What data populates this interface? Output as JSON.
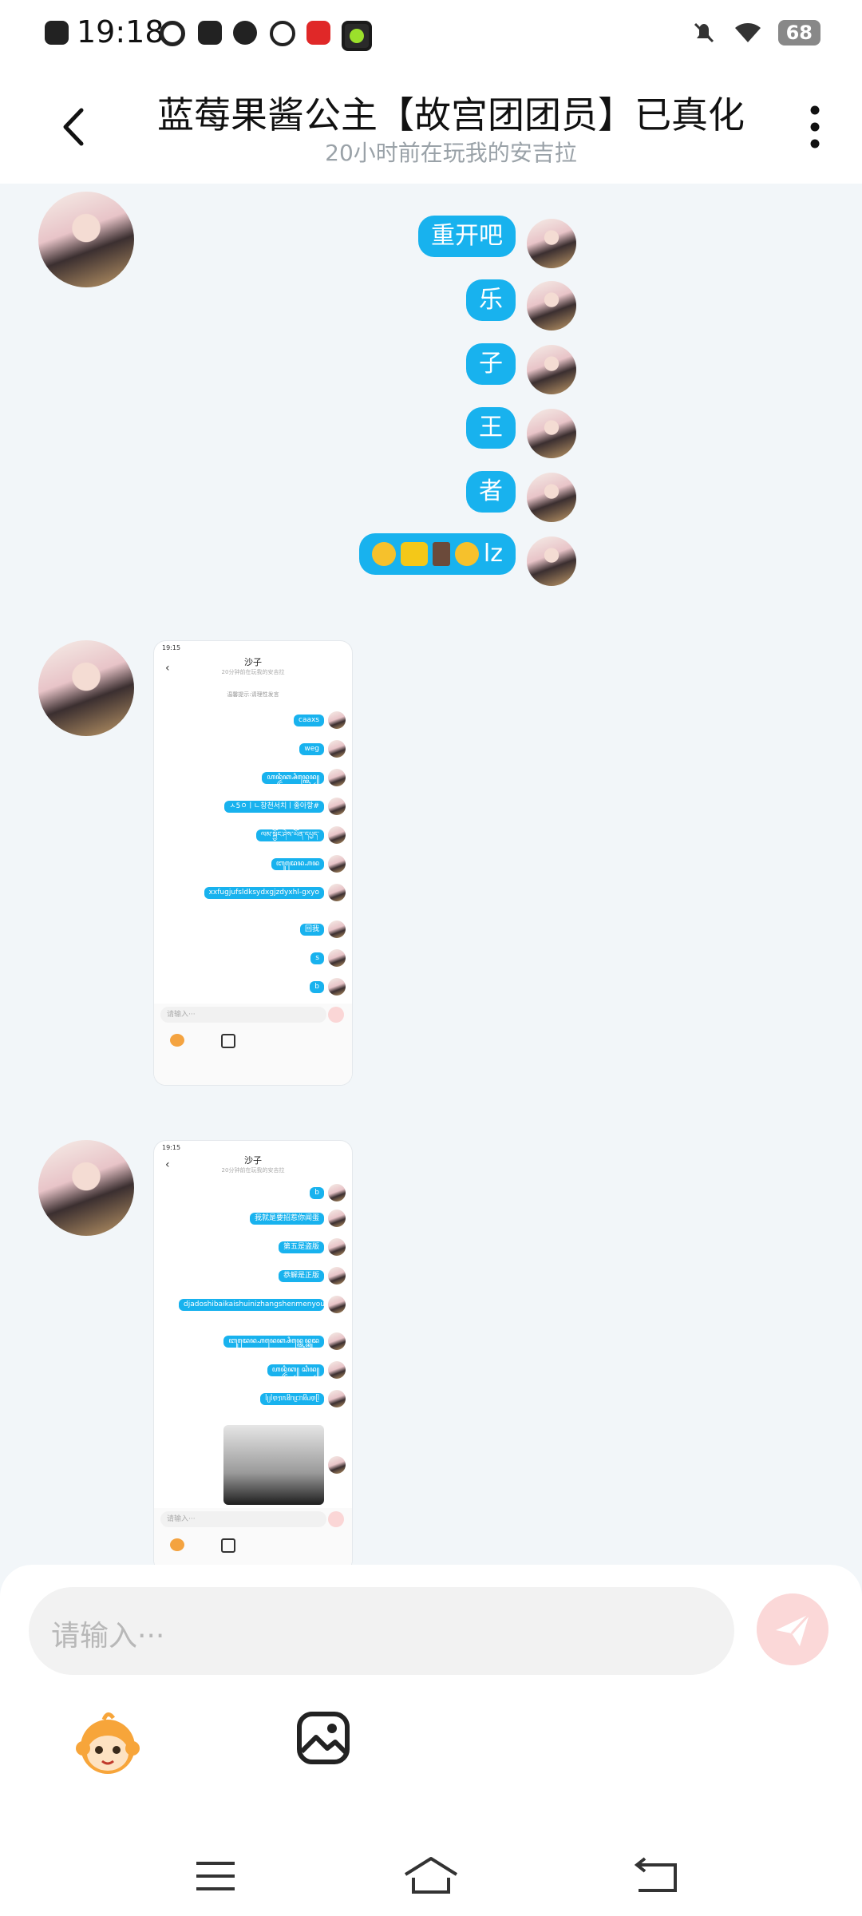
{
  "status_bar": {
    "time": "19:18",
    "battery": "68"
  },
  "header": {
    "title": "蓝莓果酱公主【故宫团团员】已真化",
    "subtitle": "20小时前在玩我的安吉拉"
  },
  "messages": [
    {
      "text": "重开吧"
    },
    {
      "text": "乐"
    },
    {
      "text": "子"
    },
    {
      "text": "王"
    },
    {
      "text": "者"
    },
    {
      "text": "lz",
      "emojis": [
        "nerd-face-emoji",
        "w-badge-emoji",
        "book-emoji",
        "crying-face-emoji"
      ]
    }
  ],
  "shot1": {
    "title": "沙子",
    "subtitle": "20分钟前在玩我的安吉拉",
    "notice": "温馨提示:请理性发言",
    "rows": [
      "caaxs",
      "weg",
      "ꦲꦤ꧀ꦢꦶꦏ꧀ꦱꦶꦤ꧀ꦠꦺꦤ꧀",
      "ㅅ5ㅇㅣㄴ창천서치ㅣ좋아핳#",
      "ལམ་སྐྱོང་ཤེས་ཡོན་དཔྱད་",
      "ꦧꦸꦢꦺꦤ꧀ꦲꦤ",
      "xxfugjufsldksydxgjzdyxhl-gxyo",
      "回我",
      "s",
      "b"
    ],
    "input_placeholder": "请输入···"
  },
  "shot2": {
    "title": "沙子",
    "subtitle": "20分钟前在玩我的安吉拉",
    "rows": [
      "b",
      "我就是要招惹你闻蛋",
      "第五是盗版",
      "恭解是正版",
      "djadoshibaikaishuinizhangshenmenyoulemei",
      "ꦧꦸꦢꦺꦤ꧀ꦲꦤꦺꦏ꧀ꦱꦶꦤ꧀ꦠꦺꦤ꧀ꦧꦸꦢ",
      "ꦲꦤ꧀ꦢꦶꦏ꧀ ꦱꦶꦤ꧀",
      "ᥣᥩᥣᥞᥟᥰᥤᥒᥨᥴᥒᥤᥙᥞᥫ"
    ],
    "input_placeholder": "请输入···"
  },
  "composer": {
    "placeholder": "请输入···"
  }
}
